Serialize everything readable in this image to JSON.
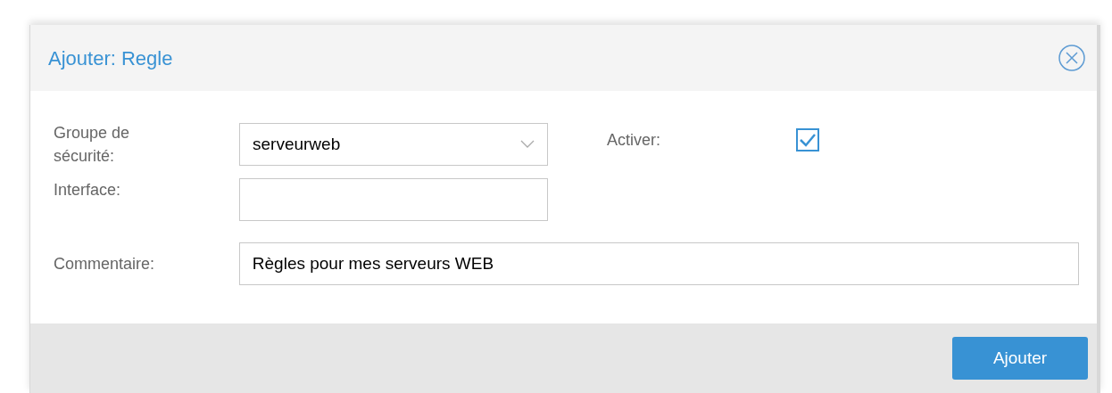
{
  "dialog": {
    "title": "Ajouter: Regle"
  },
  "fields": [
    {
      "label": "Groupe de sécurité:",
      "value": "serveurweb",
      "kind": "combo"
    },
    {
      "label": "Interface:",
      "kind": "text"
    }
  ],
  "activate": {
    "label": "Activer:",
    "checked": true
  },
  "comment": {
    "label": "Commentaire:",
    "value": "Règles pour mes serveurs WEB"
  },
  "buttons": [
    "Ajouter"
  ]
}
